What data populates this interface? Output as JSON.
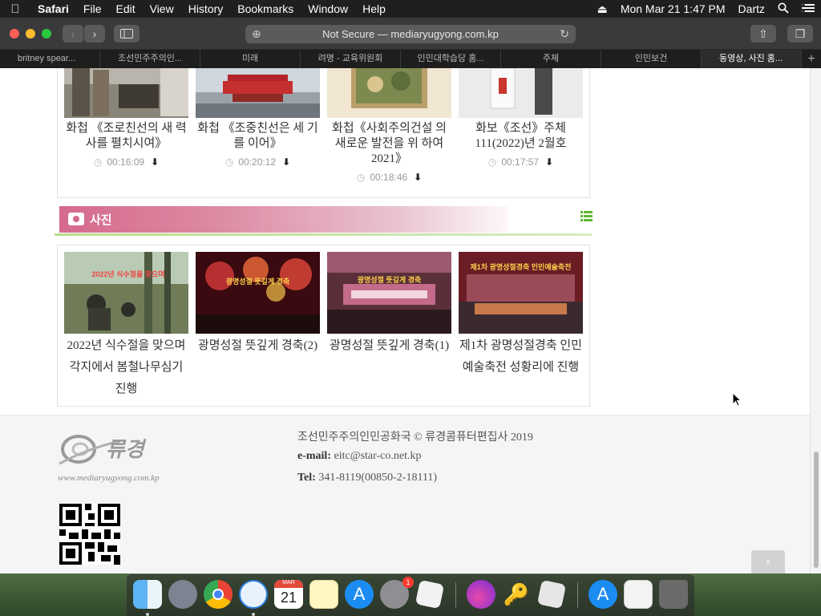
{
  "menubar": {
    "app": "Safari",
    "items": [
      "File",
      "Edit",
      "View",
      "History",
      "Bookmarks",
      "Window",
      "Help"
    ],
    "datetime": "Mon Mar 21  1:47 PM",
    "user": "Dartz"
  },
  "toolbar": {
    "url_text": "Not Secure — mediaryugyong.com.kp"
  },
  "tabs": [
    "britney spear...",
    "조선민주주의인...",
    "미래",
    "려명 - 교육위원회",
    "인민대학습당 홈...",
    "주체",
    "인민보건",
    "동영상, 사진 홈..."
  ],
  "videos": [
    {
      "caption": "화첩 《조로친선의 새 력사를 펼치시여》",
      "duration": "00:16:09"
    },
    {
      "caption": "화첩 《조중친선은 세 기를 이어》",
      "duration": "00:20:12"
    },
    {
      "caption": "화첩《사회주의건설 의 새로운 발전을 위 하여 2021》",
      "duration": "00:18:46"
    },
    {
      "caption": "화보《조선》주체 111(2022)년 2월호",
      "duration": "00:17:57"
    }
  ],
  "photo_section": {
    "title": "사진"
  },
  "photos": [
    {
      "caption": "2022년 식수절을 맞으며 각지에서 봄철나무심기 진행",
      "overlay": "2022년 식수절을 맞으며"
    },
    {
      "caption": "광명성절 뜻깊게 경축(2)",
      "overlay": "광명성절 뜻깊게 경축"
    },
    {
      "caption": "광명성절 뜻깊게 경축(1)",
      "overlay": "광명성절 뜻깊게 경축"
    },
    {
      "caption": "제1차 광명성절경축 인민예술축전 성황리에 진행",
      "overlay": "제1차 광명성절경축 인민예술축전"
    }
  ],
  "footer": {
    "logo_text": "류경",
    "logo_url": "www.mediaryugyong.com.kp",
    "copyright": "조선민주주의인민공화국 © 류경콤퓨터편집사 2019",
    "email_label": "e-mail:",
    "email": "eitc@star-co.net.kp",
    "tel_label": "Tel:",
    "tel": "341-8119(00850-2-18111)"
  },
  "dock": {
    "calendar_month": "MAR",
    "calendar_day": "21",
    "settings_badge": "1"
  },
  "colors": {
    "section_pink": "#d56a8c",
    "section_line": "#b9dc8a",
    "menubar": "#1f1f1f"
  }
}
